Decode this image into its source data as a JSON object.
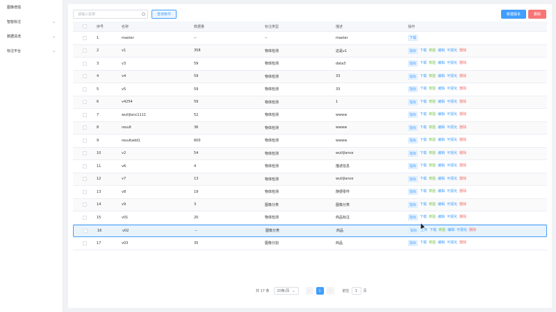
{
  "sidebar": {
    "items": [
      {
        "label": "图像增强",
        "chevron": false
      },
      {
        "label": "智能标注",
        "chevron": true
      },
      {
        "label": "数据清洗",
        "chevron": true
      },
      {
        "label": "标注平台",
        "chevron": true
      }
    ]
  },
  "toolbar": {
    "search_placeholder": "请输入名称",
    "filter_label": "查询条件",
    "new_label": "新建版本",
    "delete_label": "删除"
  },
  "table": {
    "headers": {
      "no": "序号",
      "name": "名称",
      "count": "数据量",
      "type": "标注类型",
      "desc": "描述",
      "ops": "操作"
    },
    "rows": [
      {
        "no": "1",
        "name": "master",
        "count": "--",
        "type": "--",
        "desc": "master",
        "ops": [
          "下载"
        ]
      },
      {
        "no": "2",
        "name": "v1",
        "count": "358",
        "type": "物体检测",
        "desc": "这是v1",
        "ops": [
          "指标",
          "下载",
          "校验",
          "编辑",
          "可视化",
          "删除"
        ]
      },
      {
        "no": "3",
        "name": "v3",
        "count": "59",
        "type": "物体检测",
        "desc": "data3",
        "ops": [
          "指标",
          "下载",
          "校验",
          "编辑",
          "可视化",
          "删除"
        ]
      },
      {
        "no": "4",
        "name": "v4",
        "count": "59",
        "type": "物体检测",
        "desc": "33",
        "ops": [
          "指标",
          "下载",
          "校验",
          "编辑",
          "可视化",
          "删除"
        ]
      },
      {
        "no": "5",
        "name": "v5",
        "count": "59",
        "type": "物体检测",
        "desc": "33",
        "ops": [
          "指标",
          "下载",
          "校验",
          "编辑",
          "可视化",
          "删除"
        ]
      },
      {
        "no": "6",
        "name": "v4254",
        "count": "59",
        "type": "物体检测",
        "desc": "1",
        "ops": [
          "指标",
          "下载",
          "校验",
          "编辑",
          "可视化",
          "删除"
        ]
      },
      {
        "no": "7",
        "name": "wutljlanc1111",
        "count": "52",
        "type": "物体检测",
        "desc": "wwww",
        "ops": [
          "指标",
          "下载",
          "校验",
          "编辑",
          "可视化",
          "删除"
        ]
      },
      {
        "no": "8",
        "name": "result",
        "count": "36",
        "type": "物体检测",
        "desc": "wwww",
        "ops": [
          "指标",
          "下载",
          "校验",
          "编辑",
          "可视化",
          "删除"
        ]
      },
      {
        "no": "9",
        "name": "resultadd1",
        "count": "600",
        "type": "物体检测",
        "desc": "wwww",
        "ops": [
          "指标",
          "下载",
          "校验",
          "编辑",
          "可视化",
          "删除"
        ]
      },
      {
        "no": "10",
        "name": "v2",
        "count": "54",
        "type": "物体检测",
        "desc": "wutljlance",
        "ops": [
          "指标",
          "下载",
          "校验",
          "编辑",
          "可视化",
          "删除"
        ]
      },
      {
        "no": "11",
        "name": "v6",
        "count": "4",
        "type": "物体检测",
        "desc": "描述信息",
        "ops": [
          "指标",
          "下载",
          "校验",
          "编辑",
          "可视化",
          "删除"
        ]
      },
      {
        "no": "12",
        "name": "v7",
        "count": "13",
        "type": "物体检测",
        "desc": "wutljlance",
        "ops": [
          "指标",
          "下载",
          "校验",
          "编辑",
          "可视化",
          "删除"
        ]
      },
      {
        "no": "13",
        "name": "v8",
        "count": "19",
        "type": "物体检测",
        "desc": "随便零件",
        "ops": [
          "指标",
          "下载",
          "校验",
          "编辑",
          "可视化",
          "删除"
        ]
      },
      {
        "no": "14",
        "name": "v9",
        "count": "3",
        "type": "图像分类",
        "desc": "图像分类",
        "ops": [
          "指标",
          "下载",
          "校验",
          "编辑",
          "可视化",
          "删除"
        ]
      },
      {
        "no": "15",
        "name": "v01",
        "count": "20",
        "type": "物体检测",
        "desc": "商品标注",
        "ops": [
          "指标",
          "下载",
          "校验",
          "编辑",
          "可视化",
          "删除"
        ]
      },
      {
        "no": "16",
        "name": "v02",
        "count": "--",
        "type": "图像分类",
        "desc": "商品",
        "ops": [
          "指标",
          "上传",
          "下载",
          "校验",
          "编辑",
          "可视化",
          "删除"
        ]
      },
      {
        "no": "17",
        "name": "v03",
        "count": "35",
        "type": "图像分割",
        "desc": "商品",
        "ops": [
          "指标",
          "下载",
          "校验",
          "编辑",
          "可视化",
          "删除"
        ]
      }
    ]
  },
  "pagination": {
    "total": "共 17 条",
    "page_size": "20条/页",
    "prev": "‹",
    "current": "1",
    "next": "›",
    "goto_label": "前往",
    "goto_value": "1",
    "goto_suffix": "页"
  }
}
